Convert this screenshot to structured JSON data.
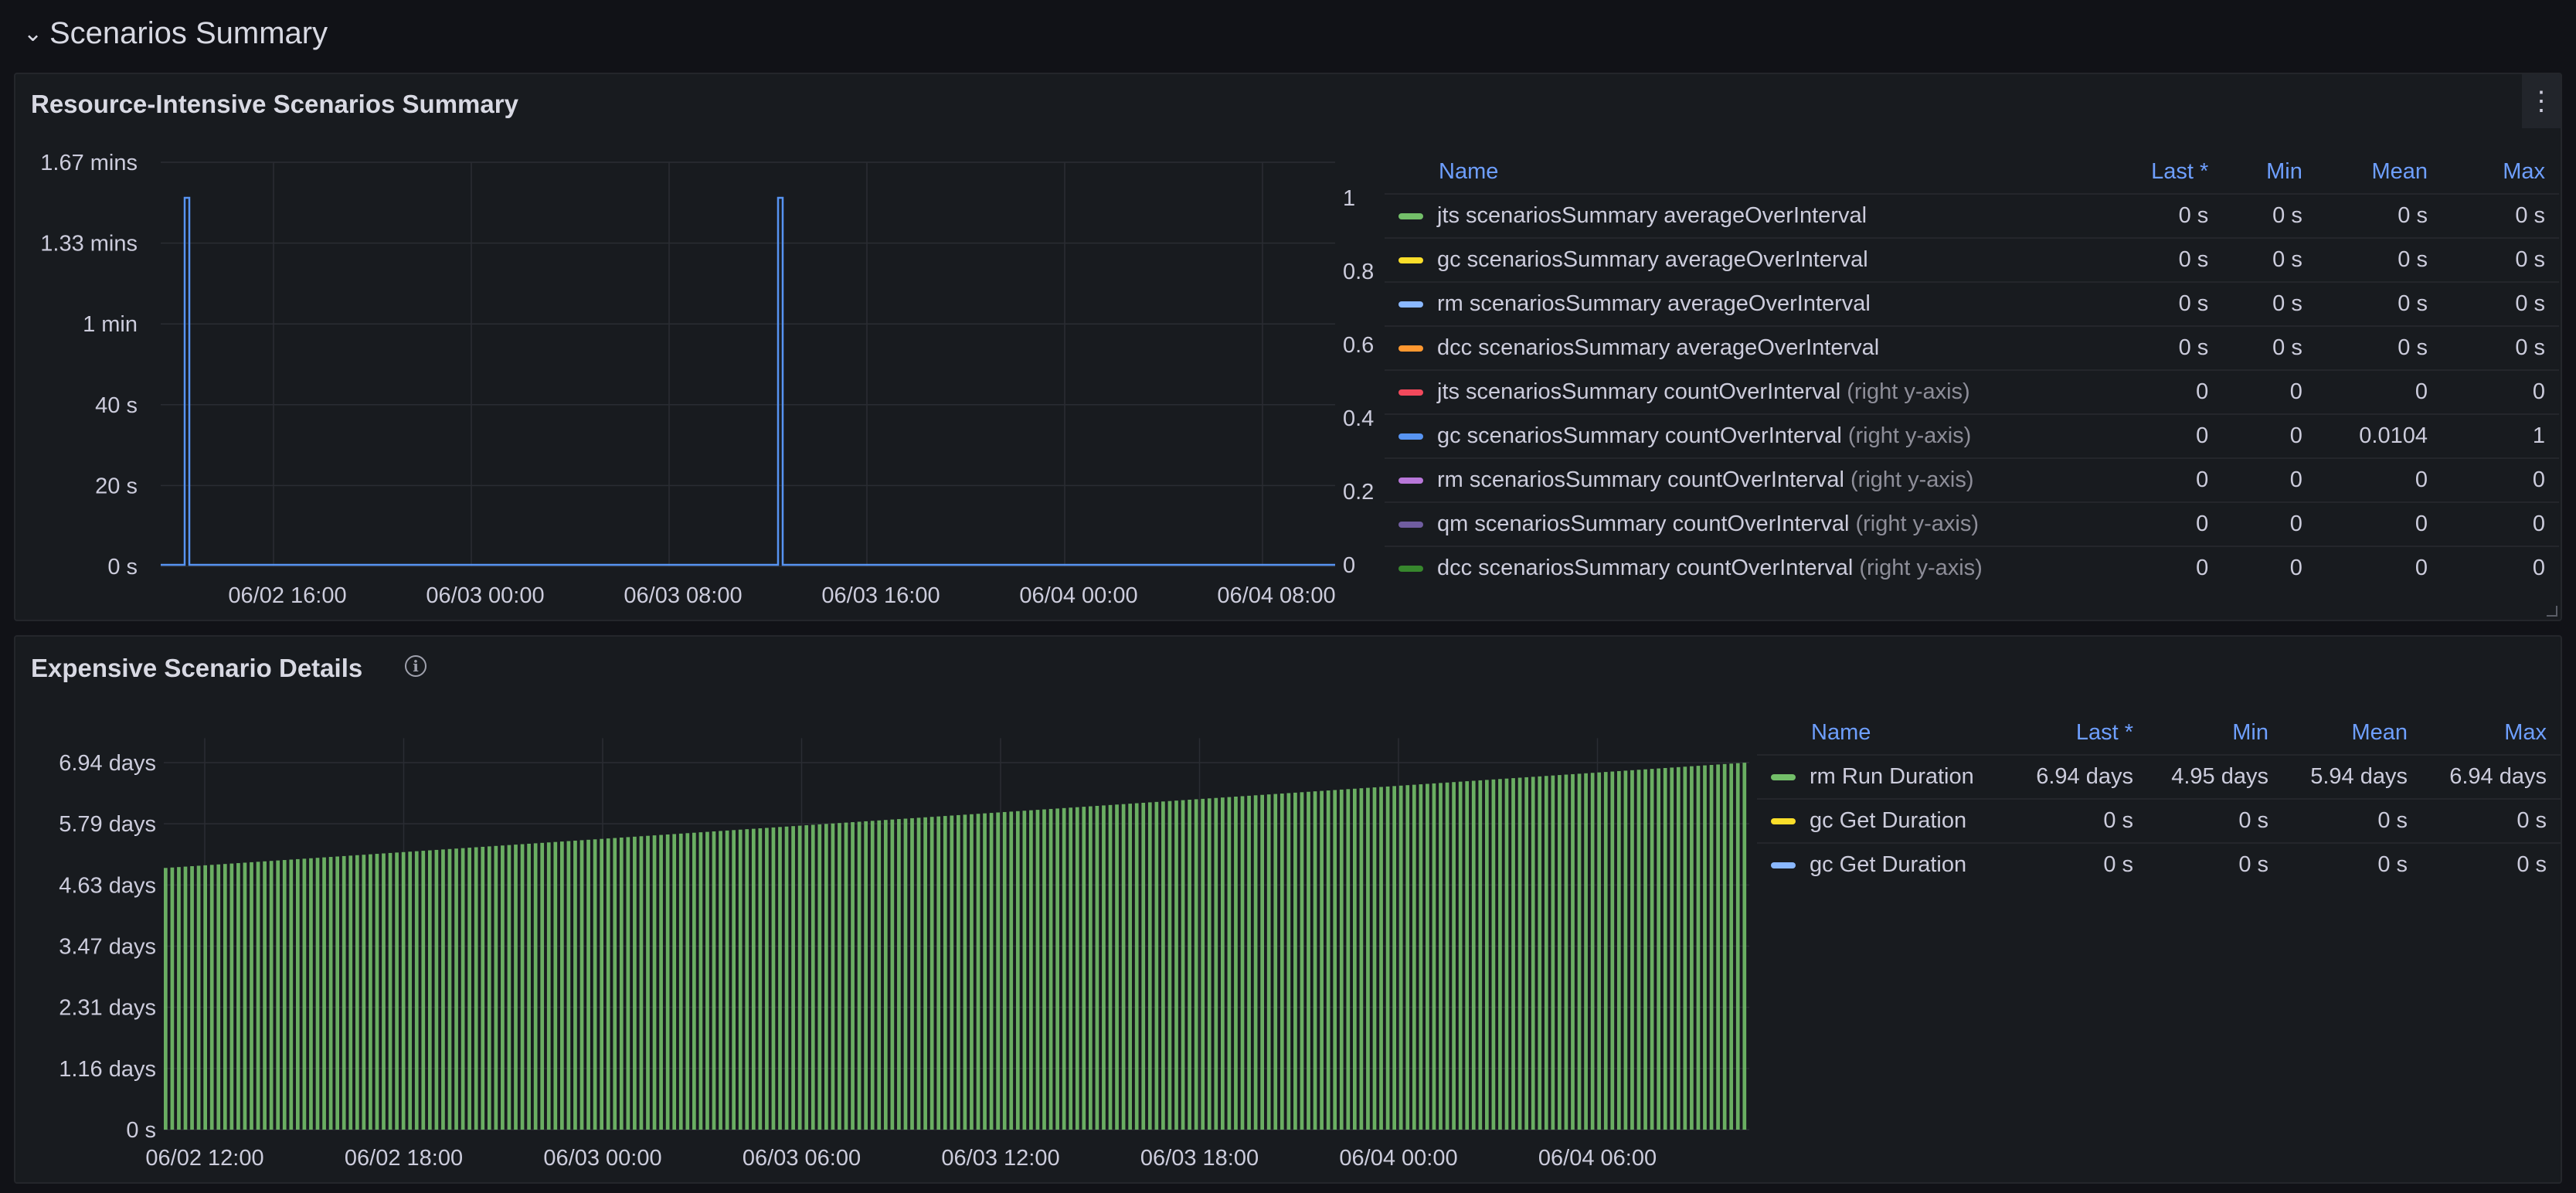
{
  "row": {
    "title": "Scenarios Summary"
  },
  "panel1": {
    "title": "Resource-Intensive Scenarios Summary",
    "legend": {
      "headers": {
        "name": "Name",
        "last": "Last *",
        "min": "Min",
        "mean": "Mean",
        "max": "Max"
      },
      "rows": [
        {
          "name": "jts scenariosSummary averageOverInterval",
          "note": "",
          "color": "#73bf69",
          "last": "0 s",
          "min": "0 s",
          "mean": "0 s",
          "max": "0 s"
        },
        {
          "name": "gc scenariosSummary averageOverInterval",
          "note": "",
          "color": "#fade2a",
          "last": "0 s",
          "min": "0 s",
          "mean": "0 s",
          "max": "0 s"
        },
        {
          "name": "rm scenariosSummary averageOverInterval",
          "note": "",
          "color": "#8ab8ff",
          "last": "0 s",
          "min": "0 s",
          "mean": "0 s",
          "max": "0 s"
        },
        {
          "name": "dcc scenariosSummary averageOverInterval",
          "note": "",
          "color": "#ff9830",
          "last": "0 s",
          "min": "0 s",
          "mean": "0 s",
          "max": "0 s"
        },
        {
          "name": "jts scenariosSummary countOverInterval",
          "note": "(right y-axis)",
          "color": "#f2495c",
          "last": "0",
          "min": "0",
          "mean": "0",
          "max": "0"
        },
        {
          "name": "gc scenariosSummary countOverInterval",
          "note": "(right y-axis)",
          "color": "#5794f2",
          "last": "0",
          "min": "0",
          "mean": "0.0104",
          "max": "1"
        },
        {
          "name": "rm scenariosSummary countOverInterval",
          "note": "(right y-axis)",
          "color": "#b877d9",
          "last": "0",
          "min": "0",
          "mean": "0",
          "max": "0"
        },
        {
          "name": "qm scenariosSummary countOverInterval",
          "note": "(right y-axis)",
          "color": "#705da0",
          "last": "0",
          "min": "0",
          "mean": "0",
          "max": "0"
        },
        {
          "name": "dcc scenariosSummary countOverInterval",
          "note": "(right y-axis)",
          "color": "#37872d",
          "last": "0",
          "min": "0",
          "mean": "0",
          "max": "0"
        }
      ]
    }
  },
  "panel2": {
    "title": "Expensive Scenario Details",
    "legend": {
      "headers": {
        "name": "Name",
        "last": "Last *",
        "min": "Min",
        "mean": "Mean",
        "max": "Max"
      },
      "rows": [
        {
          "name": "rm Run Duration",
          "color": "#73bf69",
          "last": "6.94 days",
          "min": "4.95 days",
          "mean": "5.94 days",
          "max": "6.94 days"
        },
        {
          "name": "gc Get Duration",
          "color": "#fade2a",
          "last": "0 s",
          "min": "0 s",
          "mean": "0 s",
          "max": "0 s"
        },
        {
          "name": "gc Get Duration",
          "color": "#8ab8ff",
          "last": "0 s",
          "min": "0 s",
          "mean": "0 s",
          "max": "0 s"
        }
      ]
    }
  },
  "chart_data": [
    {
      "type": "line",
      "x_ticks": [
        "06/02 16:00",
        "06/03 00:00",
        "06/03 08:00",
        "06/03 16:00",
        "06/04 00:00",
        "06/04 08:00"
      ],
      "y_ticks_left": [
        "0 s",
        "20 s",
        "40 s",
        "1 min",
        "1.33 mins",
        "1.67 mins"
      ],
      "y_ticks_right": [
        "0",
        "0.2",
        "0.4",
        "0.6",
        "0.8",
        "1"
      ],
      "ylim_right": [
        0,
        1.1
      ],
      "xlim_hours_from_x_tick_0": [
        -5.0,
        13.3
      ],
      "series": [
        {
          "name": "gc scenariosSummary countOverInterval",
          "color": "#5794f2",
          "axis": "right",
          "spikes_hours_from_x_tick_0": [
            -3.5,
            20.5
          ],
          "spike_value": 1,
          "base_value": 0
        }
      ],
      "grid": true
    },
    {
      "type": "bar",
      "x_ticks": [
        "06/02 12:00",
        "06/02 18:00",
        "06/03 00:00",
        "06/03 06:00",
        "06/03 12:00",
        "06/03 18:00",
        "06/04 00:00",
        "06/04 06:00"
      ],
      "y_ticks": [
        "0 s",
        "1.16 days",
        "2.31 days",
        "3.47 days",
        "4.63 days",
        "5.79 days",
        "6.94 days"
      ],
      "ylim_days": [
        0,
        7.4
      ],
      "series": [
        {
          "name": "rm Run Duration",
          "color": "#73bf69",
          "start_days": 4.95,
          "end_days": 6.94,
          "bar_count": 240
        }
      ],
      "grid": true
    }
  ]
}
